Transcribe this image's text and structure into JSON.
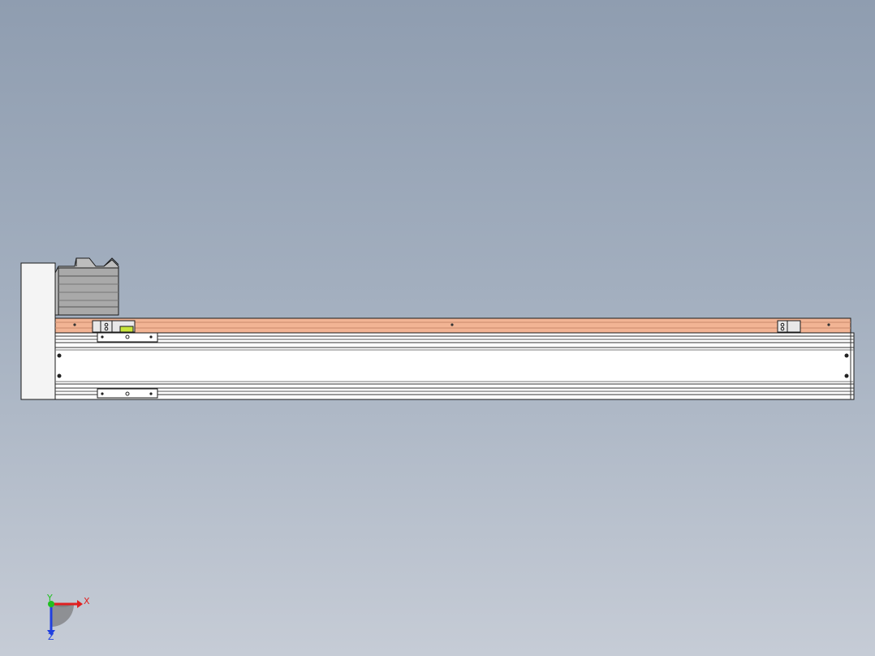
{
  "viewport": {
    "background_top": "#8f9db0",
    "background_bottom": "#c6ccd6"
  },
  "model": {
    "rail_color": "#f2b494",
    "body_color": "#ffffff",
    "motor_color": "#a9a9a9",
    "sensor_color": "#c8e63c",
    "outline_color": "#1a1a1a"
  },
  "triad": {
    "x_label": "X",
    "y_label": "Y",
    "z_label": "Z",
    "x_color": "#e02020",
    "y_color": "#20c020",
    "z_color": "#2040e0"
  }
}
